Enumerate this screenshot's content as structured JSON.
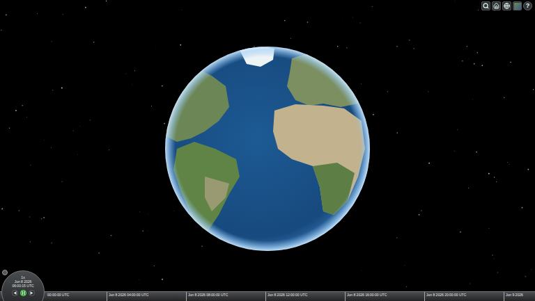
{
  "toolbar": {
    "help_label": "?"
  },
  "animation": {
    "speed": "1x",
    "date": "Jun 8 2026",
    "time": "06:00:15 UTC",
    "buttons": [
      {
        "kind": "reverse",
        "selected": false
      },
      {
        "kind": "pause",
        "selected": true
      },
      {
        "kind": "play",
        "selected": false
      }
    ]
  },
  "timeline": {
    "labels": [
      "00:00:00 UTC",
      "Jun 8 2026 04:00:00 UTC",
      "Jun 8 2026 08:00:00 UTC",
      "Jun 8 2026 12:00:00 UTC",
      "Jun 8 2026 16:00:00 UTC",
      "Jun 8 2026 20:00:00 UTC",
      "Jun 9 2026"
    ]
  }
}
